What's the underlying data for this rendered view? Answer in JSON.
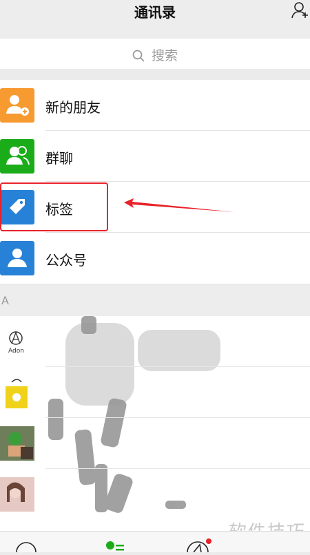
{
  "header": {
    "title": "通讯录",
    "add_contact_icon": "add-contact-icon"
  },
  "search": {
    "placeholder": "搜索",
    "icon": "search-icon"
  },
  "menu": [
    {
      "label": "新的朋友",
      "icon": "new-friends-icon",
      "color": "#f79a30"
    },
    {
      "label": "群聊",
      "icon": "group-chat-icon",
      "color": "#1aad19"
    },
    {
      "label": "标签",
      "icon": "tag-icon",
      "color": "#2782d7"
    },
    {
      "label": "公众号",
      "icon": "official-accounts-icon",
      "color": "#2782d7"
    }
  ],
  "section": {
    "letter": "A"
  },
  "avatars": [
    {
      "text": "Adon"
    },
    {
      "text": ""
    },
    {
      "text": ""
    },
    {
      "text": ""
    }
  ],
  "annotation": {
    "highlight_color": "#e8222b"
  },
  "watermark": {
    "text": "软件技巧"
  },
  "tabbar": {
    "icons": [
      "chats-icon",
      "contacts-icon",
      "discover-icon"
    ]
  }
}
